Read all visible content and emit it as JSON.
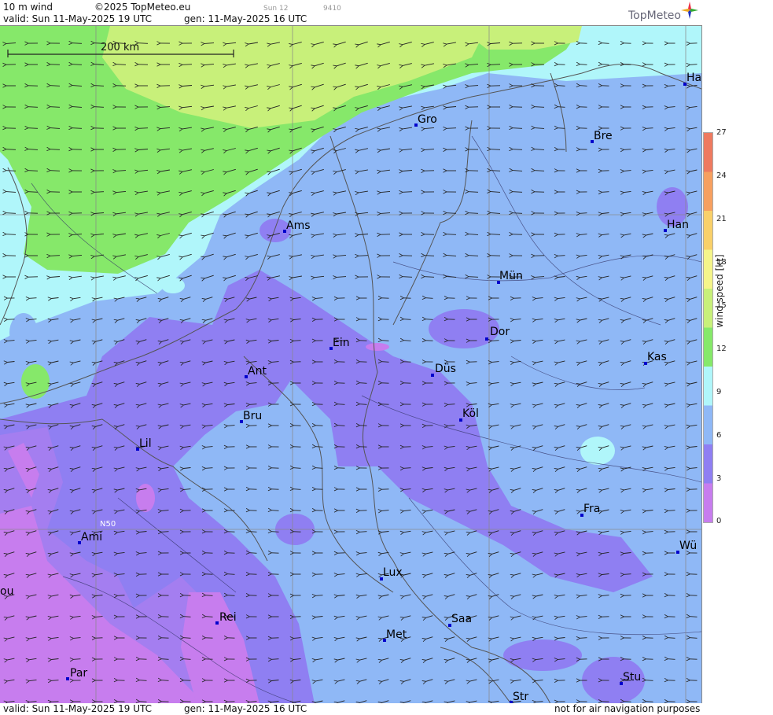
{
  "header": {
    "title": "10 m wind",
    "copyright": "©2025 TopMeteo.eu",
    "valid": "valid:  Sun  11-May-2025  19 UTC",
    "gen": "gen: 11-May-2025 16 UTC",
    "run_tag": "Sun 12",
    "code": "9410",
    "logo": "TopMeteo"
  },
  "footer": {
    "valid": "valid:  Sun  11-May-2025  19 UTC",
    "gen": "gen: 11-May-2025 16 UTC",
    "note": "not for air navigation purposes"
  },
  "map": {
    "scale_label": "200 km",
    "lat_label": "N50",
    "cities": [
      {
        "name": "Gro"
      },
      {
        "name": "Bre"
      },
      {
        "name": "Ha"
      },
      {
        "name": "Ams"
      },
      {
        "name": "Han"
      },
      {
        "name": "Mün"
      },
      {
        "name": "Dor"
      },
      {
        "name": "Ein"
      },
      {
        "name": "Kas"
      },
      {
        "name": "Ant"
      },
      {
        "name": "Düs"
      },
      {
        "name": "Bru"
      },
      {
        "name": "Köl"
      },
      {
        "name": "Lil"
      },
      {
        "name": "Fra"
      },
      {
        "name": "Ami"
      },
      {
        "name": "Wü"
      },
      {
        "name": "Lux"
      },
      {
        "name": "ou"
      },
      {
        "name": "Rei"
      },
      {
        "name": "Saa"
      },
      {
        "name": "Met"
      },
      {
        "name": "Stu"
      },
      {
        "name": "Par"
      },
      {
        "name": "Str"
      }
    ]
  },
  "legend": {
    "axis_label": "wind  speed  [kt]",
    "ticks": [
      "27",
      "24",
      "21",
      "18",
      "15",
      "12",
      "9",
      "6",
      "3",
      "0"
    ],
    "colors": [
      "#c77dee",
      "#8f7ff2",
      "#8fb8f6",
      "#b0f6fa",
      "#86e86a",
      "#c8f07a",
      "#f5f58a",
      "#f9d06a",
      "#f7a060",
      "#ee7a60"
    ]
  }
}
